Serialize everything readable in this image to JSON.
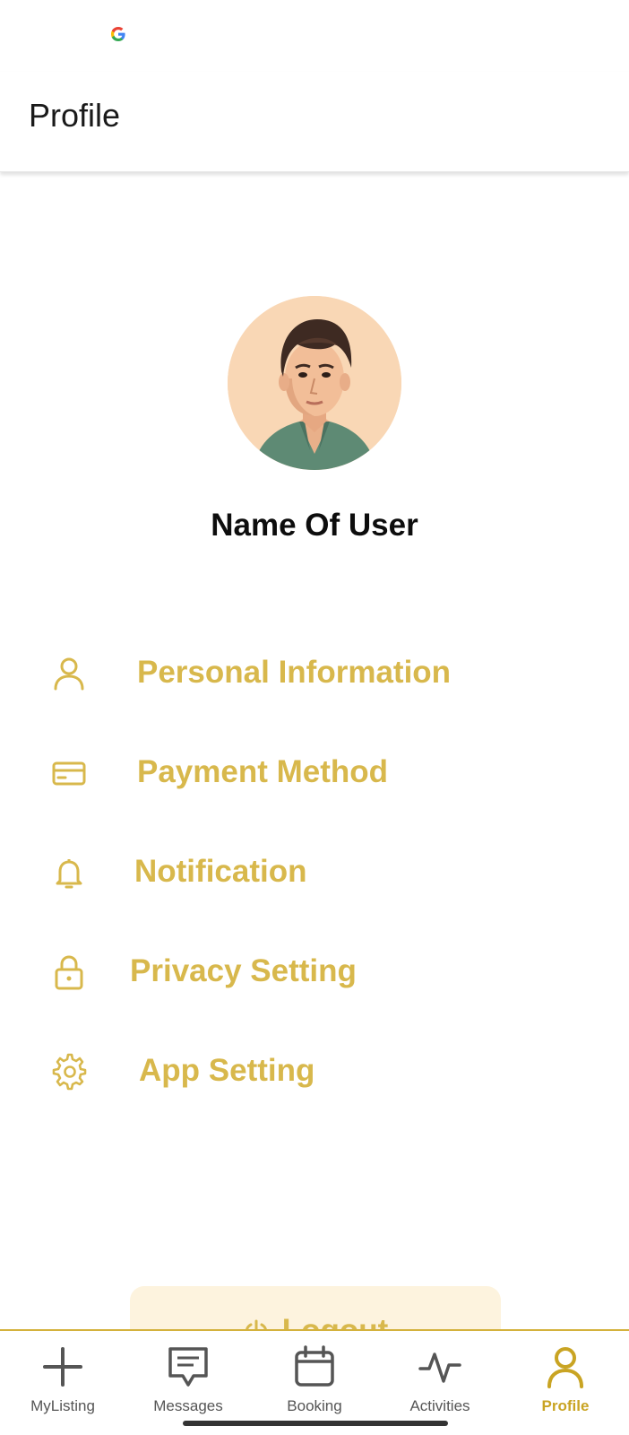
{
  "header": {
    "title": "Profile"
  },
  "profile": {
    "name": "Name Of User"
  },
  "menu": {
    "items": [
      {
        "label": "Personal Information",
        "icon": "person-icon"
      },
      {
        "label": "Payment Method",
        "icon": "credit-card-icon"
      },
      {
        "label": "Notification",
        "icon": "bell-icon"
      },
      {
        "label": "Privacy Setting",
        "icon": "lock-icon"
      },
      {
        "label": "App Setting",
        "icon": "gear-icon"
      }
    ]
  },
  "logout": {
    "label": "Logout",
    "icon": "power-icon"
  },
  "nav": {
    "items": [
      {
        "label": "MyListing",
        "icon": "plus-icon"
      },
      {
        "label": "Messages",
        "icon": "message-icon"
      },
      {
        "label": "Booking",
        "icon": "calendar-icon"
      },
      {
        "label": "Activities",
        "icon": "activity-icon"
      },
      {
        "label": "Profile",
        "icon": "person-icon",
        "active": true
      }
    ]
  },
  "colors": {
    "accent": "#d8b84c",
    "nav_active": "#c9a423",
    "logout_bg": "#fdf3de"
  }
}
